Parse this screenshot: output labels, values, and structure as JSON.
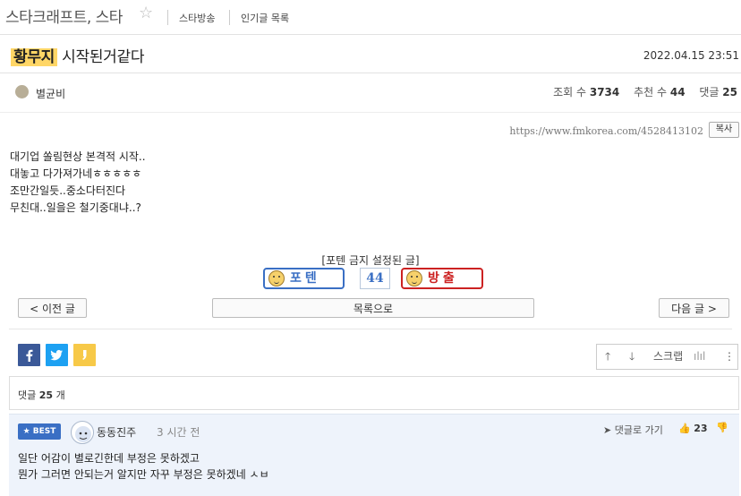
{
  "header": {
    "board_title": "스타크래프트, 스타",
    "star_icon": "star-outline-icon",
    "links": [
      "스타방송",
      "인기글 목록"
    ]
  },
  "post": {
    "title_highlight": "황무지",
    "title_rest": " 시작된거같다",
    "date": "2022.04.15 23:51",
    "author": "별균비",
    "stats": {
      "views_label": "조회 수",
      "views": "3734",
      "likes_label": "추천 수",
      "likes": "44",
      "comments_label": "댓글",
      "comments": "25"
    },
    "url": "https://www.fmkorea.com/4528413102",
    "copy_label": "복사",
    "body_lines": [
      "대기업 쏠림현상 본격적 시작..",
      "대놓고 다가져가네ㅎㅎㅎㅎㅎ",
      "조만간일듯..중소다터진다",
      "무친대..일을은 철기중대냐..?"
    ]
  },
  "vote": {
    "label": "[포텐 금지 설정된 글]",
    "up_label": "포텐",
    "count": "44",
    "down_label": "방출",
    "up_color": "#3a6fc4",
    "down_color": "#cc2222"
  },
  "nav": {
    "prev": "< 이전 글",
    "list": "목록으로",
    "next": "다음 글 >"
  },
  "share": {
    "icons": [
      "facebook-icon",
      "twitter-icon",
      "kakaostory-icon"
    ],
    "facebook_color": "#3b5998",
    "twitter_color": "#1da1f2",
    "kakao_color": "#f7c948"
  },
  "tools": {
    "scrap_label": "스크랩"
  },
  "comments": {
    "count_label": "댓글",
    "count": "25",
    "count_suffix": "개",
    "items": [
      {
        "badge": "BEST",
        "author": "동동진주",
        "time": "3 시간 전",
        "reply_label": "댓글로 가기",
        "likes": "23",
        "lines": [
          "일단 어감이 별로긴한데 부정은 못하겠고",
          "뭔가 그러면 안되는거 알지만 자꾸 부정은 못하겠네 ㅅㅂ"
        ]
      }
    ]
  }
}
